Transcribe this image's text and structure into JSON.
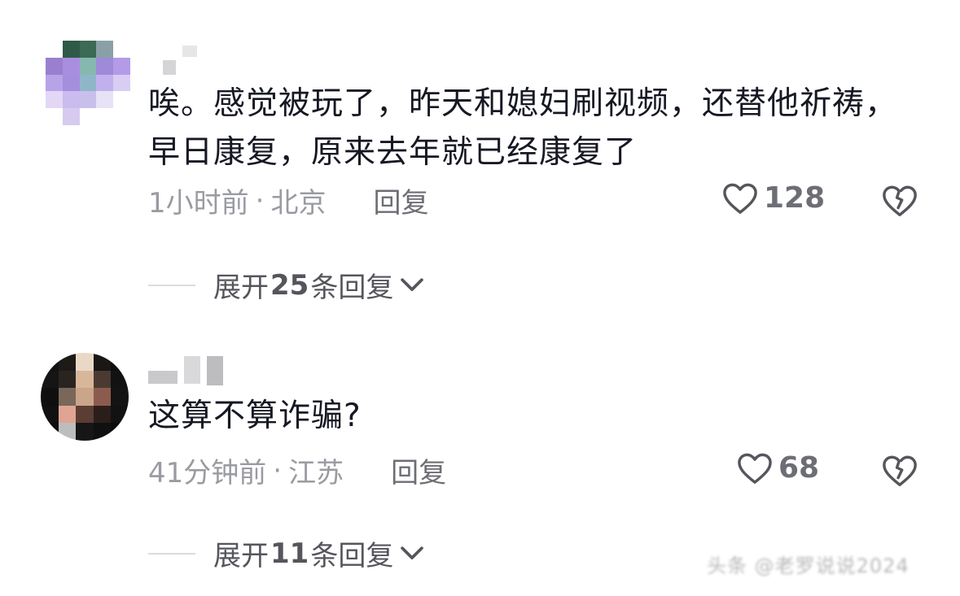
{
  "comments": [
    {
      "text": "唉。感觉被玩了，昨天和媳妇刷视频，还替他祈祷，早日康复，原来去年就已经康复了",
      "time": "1小时前",
      "separator": "·",
      "location": "北京",
      "reply_label": "回复",
      "like_count": "128",
      "expand": {
        "prefix": "展开",
        "count": "25",
        "suffix": "条回复"
      }
    },
    {
      "text": "这算不算诈骗?",
      "time": "41分钟前",
      "separator": "·",
      "location": "江苏",
      "reply_label": "回复",
      "like_count": "68",
      "expand": {
        "prefix": "展开",
        "count": "11",
        "suffix": "条回复"
      }
    }
  ],
  "watermark": "头条 @老罗说说2024",
  "icons": {
    "like": "heart-outline-icon",
    "dislike": "broken-heart-icon",
    "expand": "chevron-down-icon"
  },
  "colors": {
    "text": "#161823",
    "meta": "#9a9ba2",
    "secondary": "#6d6e75"
  }
}
